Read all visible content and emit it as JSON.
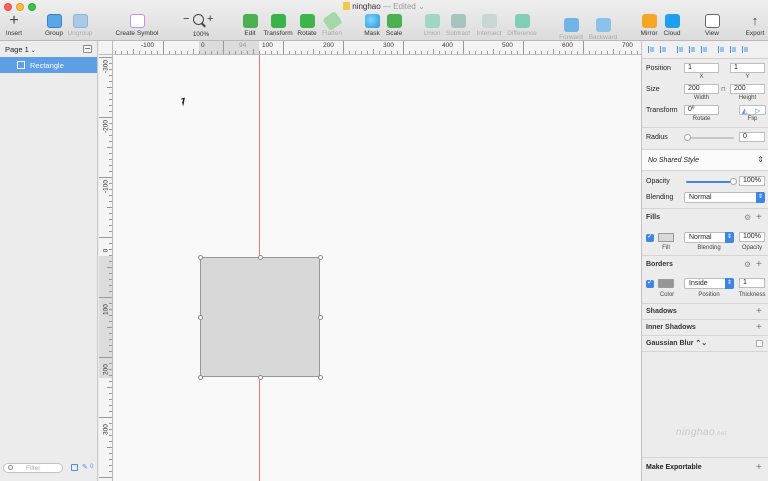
{
  "window": {
    "title": "ninghao",
    "status": "— Edited",
    "status_chevron": "⌄"
  },
  "toolbar": {
    "insert": "Insert",
    "group": "Group",
    "ungroup": "Ungroup",
    "create_symbol": "Create Symbol",
    "zoom_minus": "−",
    "zoom_plus": "+",
    "zoom_level": "100%",
    "edit": "Edit",
    "transform": "Transform",
    "rotate": "Rotate",
    "flatten": "Flatten",
    "mask": "Mask",
    "scale": "Scale",
    "union": "Union",
    "subtract": "Subtract",
    "intersect": "Intersect",
    "difference": "Difference",
    "forward": "Forward",
    "backward": "Backward",
    "mirror": "Mirror",
    "cloud": "Cloud",
    "view": "View",
    "export": "Export"
  },
  "sidebar": {
    "page": "Page 1",
    "page_chevron": "⌄",
    "layers": [
      {
        "name": "Rectangle",
        "selected": true
      }
    ],
    "filter_placeholder": "Filter",
    "layer_count": "0"
  },
  "rulers": {
    "top": [
      "-100",
      "0",
      "100",
      "200",
      "300",
      "400",
      "500",
      "600",
      "700"
    ],
    "top_highlight": "94",
    "left": [
      "-300",
      "-200",
      "-100",
      "0",
      "100",
      "200",
      "300"
    ]
  },
  "inspector": {
    "position_label": "Position",
    "position_x": "1",
    "position_y": "1",
    "x_label": "X",
    "y_label": "Y",
    "size_label": "Size",
    "width": "200",
    "height": "200",
    "lock_icon": "🔒",
    "width_label": "Width",
    "height_label": "Height",
    "transform_label": "Transform",
    "rotate_value": "0º",
    "rotate_label": "Rotate",
    "flip_label": "Flip",
    "radius_label": "Radius",
    "radius_value": "0",
    "shared_style": "No Shared Style",
    "opacity_label": "Opacity",
    "opacity_value": "100%",
    "opacity": 1.0,
    "blending_label": "Blending",
    "blending_value": "Normal",
    "fills_header": "Fills",
    "fill_blend": "Normal",
    "fill_opacity": "100%",
    "fill_label": "Fill",
    "fill_blending_label": "Blending",
    "fill_opacity_label": "Opacity",
    "fill_color": "#d8d8d8",
    "borders_header": "Borders",
    "border_position": "Inside",
    "border_thickness": "1",
    "color_label": "Color",
    "position_sub_label": "Position",
    "thickness_label": "Thickness",
    "border_color": "#979797",
    "shadows_header": "Shadows",
    "inner_shadows_header": "Inner Shadows",
    "gaussian_blur_header": "Gaussian Blur",
    "gaussian_chevron": "⌃⌄",
    "make_exportable": "Make Exportable",
    "watermark": "ninghao",
    "watermark_suffix": ".net"
  },
  "colors": {
    "accent": "#3d86e3",
    "selection": "#5d9fe6",
    "guide": "#f07878"
  }
}
